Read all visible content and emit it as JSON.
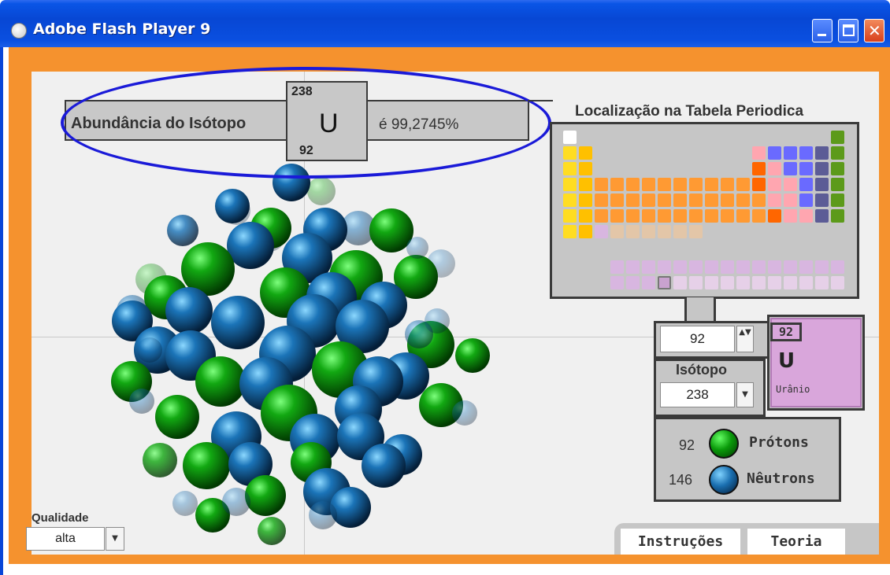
{
  "window": {
    "title": "Adobe Flash Player 9",
    "close_glyph": "✕"
  },
  "isotope_banner": {
    "label": "Abundância do Isótopo",
    "mass_number": "238",
    "atomic_number": "92",
    "symbol": "U",
    "abundance": "é 99,2745%"
  },
  "periodic_table": {
    "title": "Localização na Tabela Periodica",
    "colors": {
      "alkali": "#ffdd22",
      "alkaline": "#ffc000",
      "transition": "#ff9a33",
      "nonmetal": "#ff6600",
      "pink": "#ffa6b0",
      "blue": "#6a6aff",
      "slate": "#5c5c96",
      "noble": "#5c9a1a",
      "lanthanide": "#d8b6e0",
      "selected": "#c9a2cf",
      "hydrogen": "#ffffff"
    }
  },
  "controls": {
    "atomic_number_value": "92",
    "element_card": {
      "number": "92",
      "symbol": "U",
      "name": "Urânio",
      "color": "#d9a6db"
    },
    "isotope": {
      "label": "Isótopo",
      "value": "238"
    },
    "protons": {
      "count": "92",
      "label": "Prótons",
      "color": "#0a9a0a"
    },
    "neutrons": {
      "count": "146",
      "label": "Nêutrons",
      "color": "#1a6fb0"
    },
    "quality": {
      "label": "Qualidade",
      "value": "alta"
    },
    "spinner_glyph": "▲▼",
    "dropdown_glyph": "▼"
  },
  "tabs": [
    {
      "label": "Instruções"
    },
    {
      "label": "Teoria"
    }
  ]
}
